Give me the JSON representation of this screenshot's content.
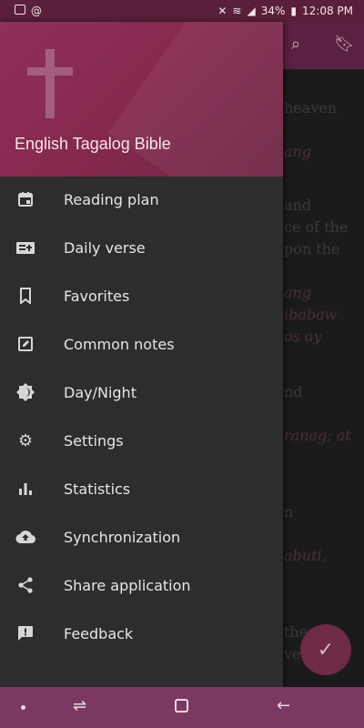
{
  "status_bar": {
    "battery": "34%",
    "time": "12:08 PM"
  },
  "drawer": {
    "title": "English Tagalog Bible",
    "items": [
      {
        "label": "Reading plan",
        "icon": "calendar-icon"
      },
      {
        "label": "Daily verse",
        "icon": "daily-verse-icon"
      },
      {
        "label": "Favorites",
        "icon": "bookmark-icon"
      },
      {
        "label": "Common notes",
        "icon": "edit-note-icon"
      },
      {
        "label": "Day/Night",
        "icon": "brightness-icon"
      },
      {
        "label": "Settings",
        "icon": "gear-icon"
      },
      {
        "label": "Statistics",
        "icon": "bar-chart-icon"
      },
      {
        "label": "Synchronization",
        "icon": "cloud-upload-icon"
      },
      {
        "label": "Share application",
        "icon": "share-icon"
      },
      {
        "label": "Feedback",
        "icon": "feedback-icon"
      }
    ]
  },
  "background_text": [
    {
      "text": "heaven",
      "italic": false
    },
    {
      "text": "ang",
      "italic": true
    },
    {
      "text": "and",
      "italic": false
    },
    {
      "text": "ce of the",
      "italic": false
    },
    {
      "text": "pon the",
      "italic": false
    },
    {
      "text": "ang",
      "italic": true
    },
    {
      "text": "ibabaw",
      "italic": true
    },
    {
      "text": "os ay",
      "italic": true
    },
    {
      "text": "nd",
      "italic": false
    },
    {
      "text": "ranag; at",
      "italic": true
    },
    {
      "text": "n",
      "italic": false
    },
    {
      "text": "abuti,",
      "italic": true
    },
    {
      "text": "the",
      "italic": false
    },
    {
      "text": "ve",
      "italic": false
    }
  ],
  "colors": {
    "header": "#8f2f5a",
    "drawer_bg": "#2d2d2d",
    "nav_bar": "#7a3862",
    "fab": "#6f2a48"
  }
}
